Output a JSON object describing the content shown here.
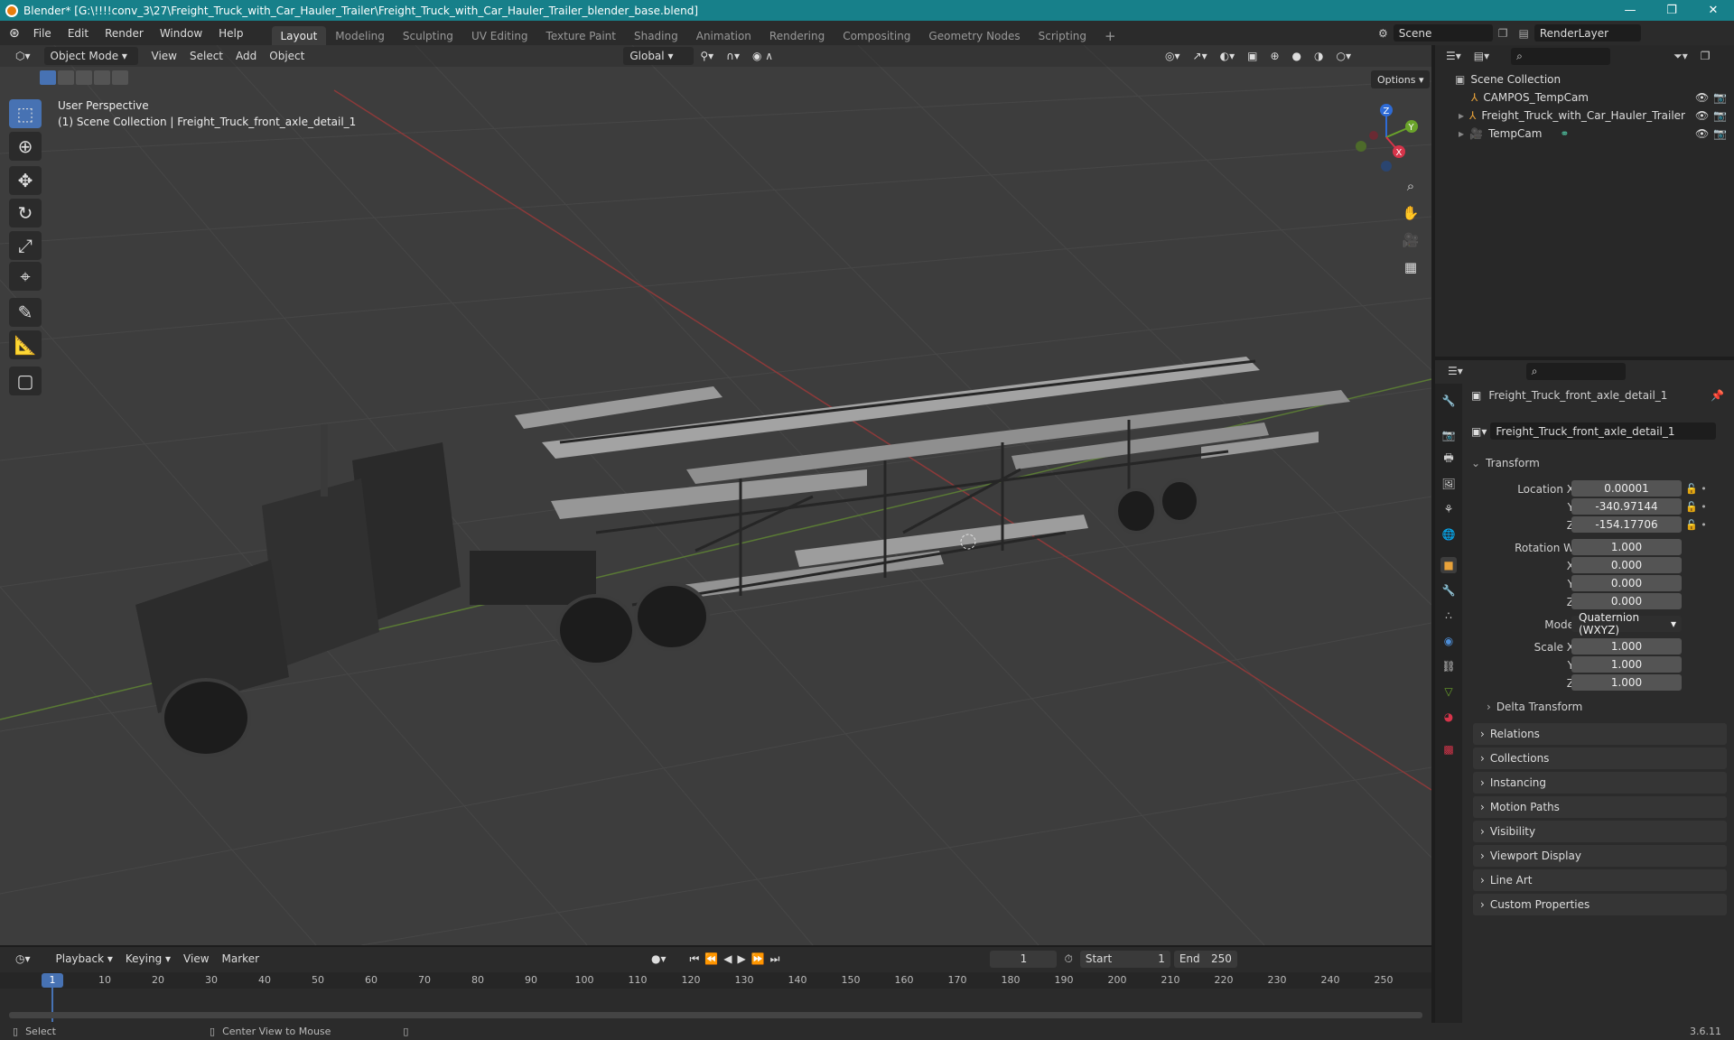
{
  "window": {
    "title": "Blender* [G:\\!!!!conv_3\\27\\Freight_Truck_with_Car_Hauler_Trailer\\Freight_Truck_with_Car_Hauler_Trailer_blender_base.blend]",
    "minimize": "—",
    "maximize": "❐",
    "close": "✕"
  },
  "menu": [
    "File",
    "Edit",
    "Render",
    "Window",
    "Help"
  ],
  "workspaces": [
    "Layout",
    "Modeling",
    "Sculpting",
    "UV Editing",
    "Texture Paint",
    "Shading",
    "Animation",
    "Rendering",
    "Compositing",
    "Geometry Nodes",
    "Scripting"
  ],
  "add_workspace": "+",
  "scene": {
    "name": "Scene",
    "render_layer": "RenderLayer"
  },
  "viewport": {
    "mode": "Object Mode",
    "menus": [
      "View",
      "Select",
      "Add",
      "Object"
    ],
    "transform_orient": "Global",
    "options": "Options",
    "perspective": "User Perspective",
    "context": "(1) Scene Collection | Freight_Truck_front_axle_detail_1",
    "gizmo": {
      "x": "X",
      "y": "Y",
      "z": "Z"
    }
  },
  "outliner": {
    "root": "Scene Collection",
    "items": [
      {
        "name": "CAMPOS_TempCam"
      },
      {
        "name": "Freight_Truck_with_Car_Hauler_Trailer"
      },
      {
        "name": "TempCam"
      }
    ]
  },
  "properties": {
    "object_name": "Freight_Truck_front_axle_detail_1",
    "data_name": "Freight_Truck_front_axle_detail_1",
    "transform": "Transform",
    "location": {
      "label": "Location X",
      "x": "0.00001",
      "y": "-340.97144",
      "z": "-154.17706"
    },
    "rotation": {
      "label": "Rotation W",
      "w": "1.000",
      "x": "0.000",
      "y": "0.000",
      "z": "0.000"
    },
    "mode_label": "Mode",
    "mode": "Quaternion (WXYZ)",
    "scale": {
      "label": "Scale X",
      "x": "1.000",
      "y": "1.000",
      "z": "1.000"
    },
    "axis": {
      "x": "X",
      "y": "Y",
      "z": "Z"
    },
    "delta": "Delta Transform",
    "sections": [
      "Relations",
      "Collections",
      "Instancing",
      "Motion Paths",
      "Visibility",
      "Viewport Display",
      "Line Art",
      "Custom Properties"
    ]
  },
  "timeline": {
    "menus": [
      "Playback",
      "Keying",
      "View",
      "Marker"
    ],
    "current": "1",
    "start_label": "Start",
    "start": "1",
    "end_label": "End",
    "end": "250",
    "ticks": [
      "10",
      "20",
      "30",
      "40",
      "50",
      "60",
      "70",
      "80",
      "90",
      "100",
      "110",
      "120",
      "130",
      "140",
      "150",
      "160",
      "170",
      "180",
      "190",
      "200",
      "210",
      "220",
      "230",
      "240",
      "250"
    ]
  },
  "status": {
    "select": "Select",
    "center": "Center View to Mouse",
    "version": "3.6.11"
  }
}
